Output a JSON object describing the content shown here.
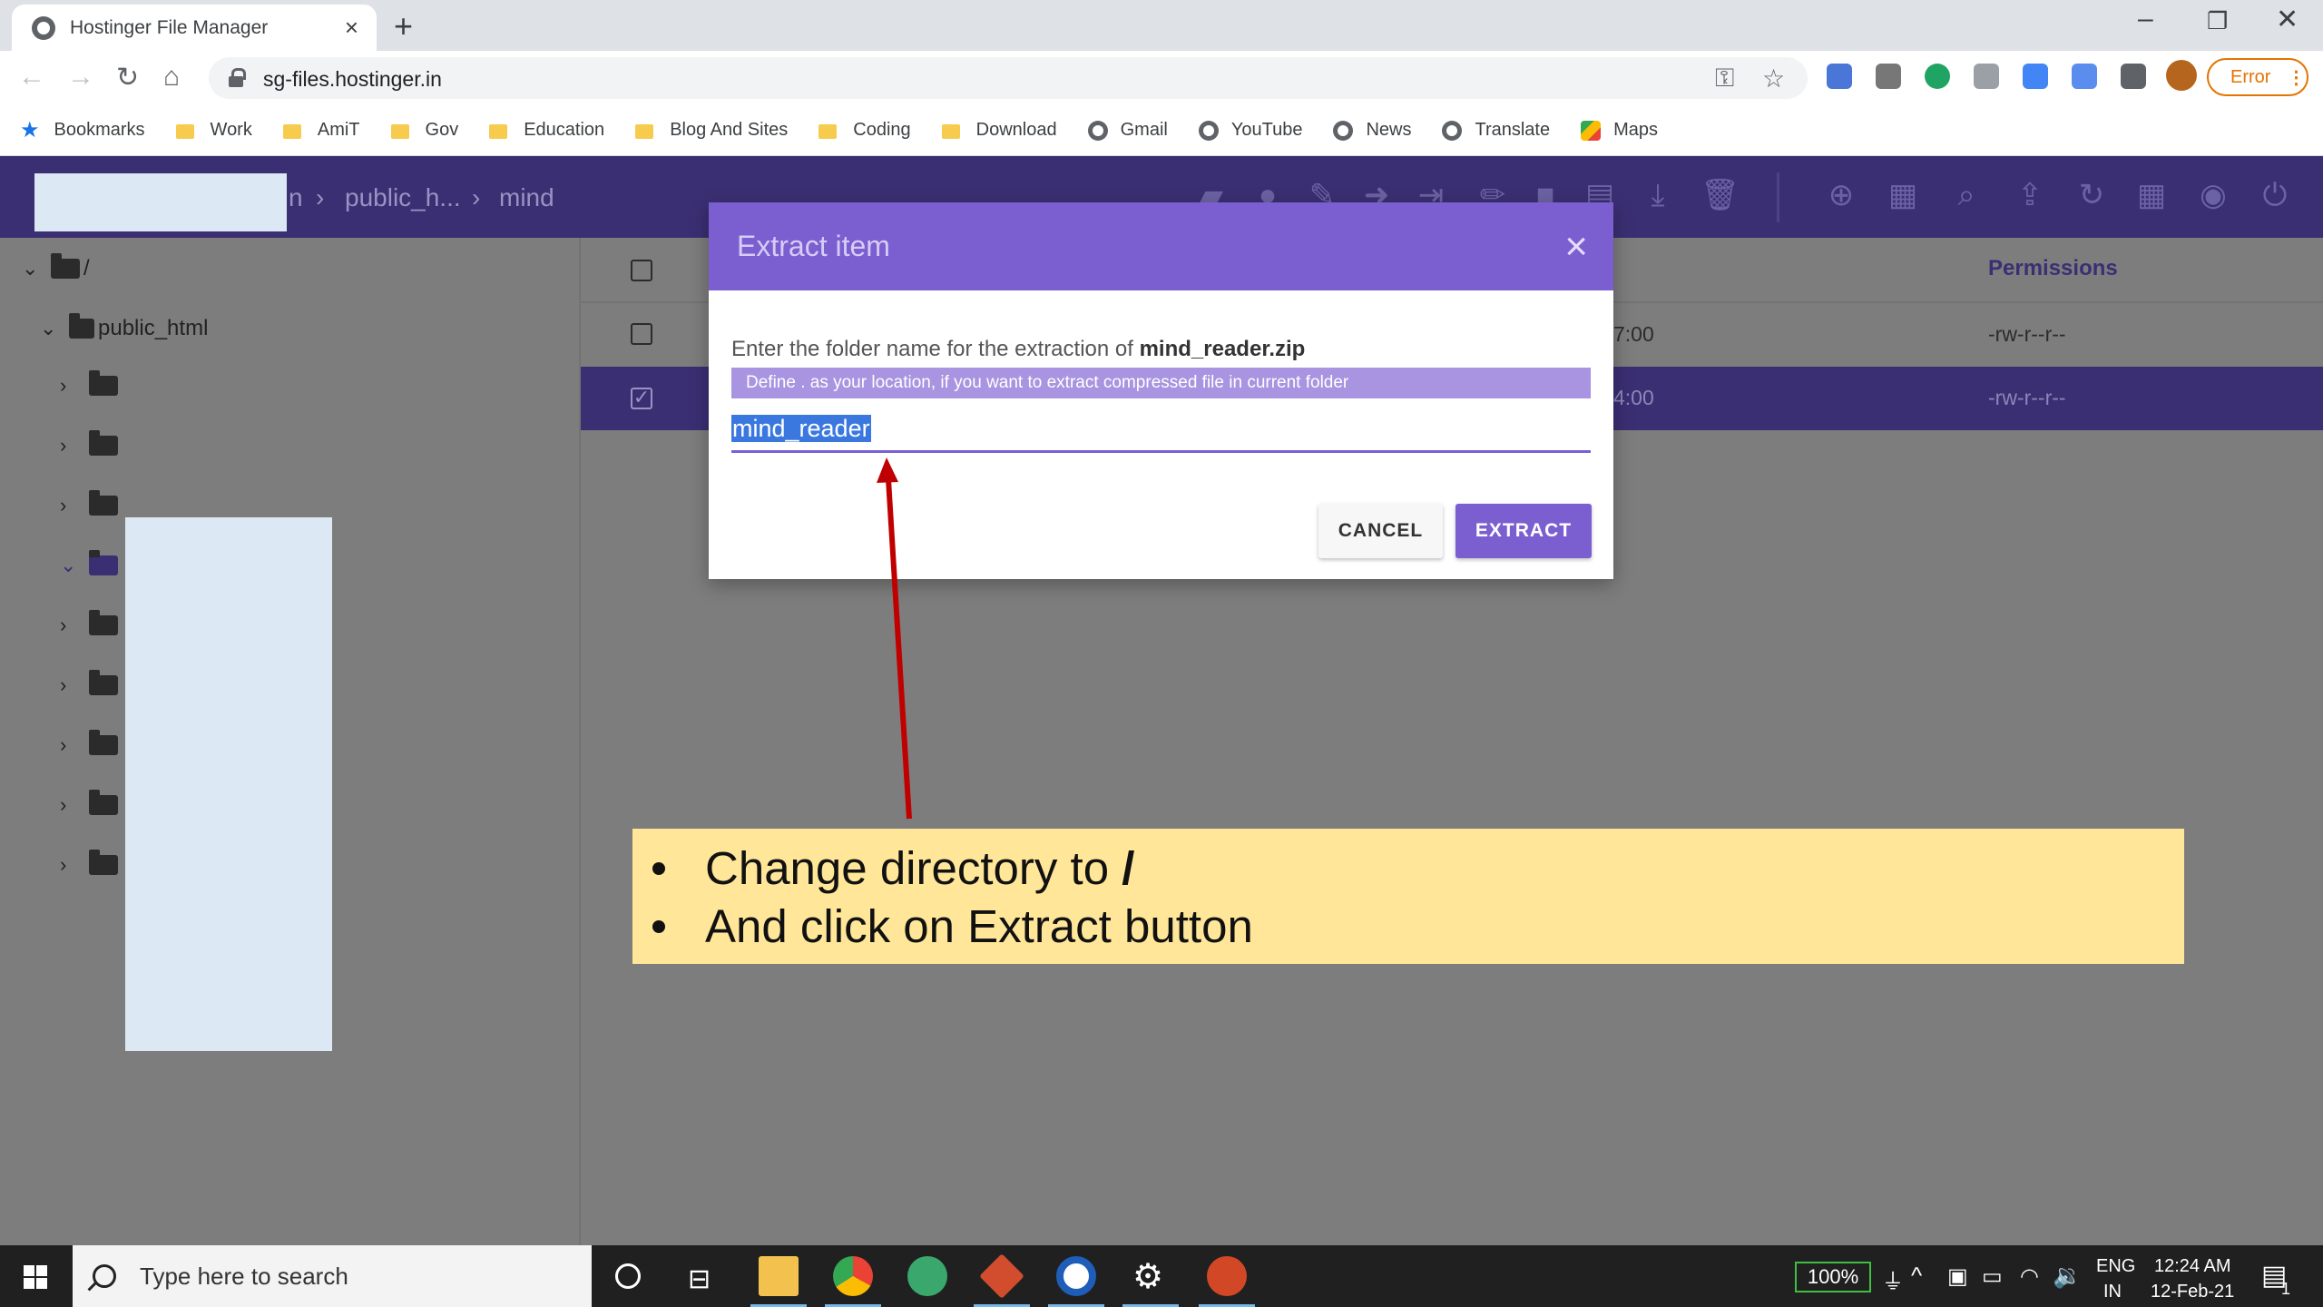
{
  "browser": {
    "tab_title": "Hostinger File Manager",
    "tab_close": "×",
    "new_tab": "+",
    "url": "sg-files.hostinger.in",
    "error_label": "Error",
    "error_menu": "⋮",
    "bookmarks": [
      {
        "label": "Bookmarks",
        "icon": "star-icon"
      },
      {
        "label": "Work",
        "icon": "folder-icon"
      },
      {
        "label": "AmiT",
        "icon": "folder-icon"
      },
      {
        "label": "Gov",
        "icon": "folder-icon"
      },
      {
        "label": "Education",
        "icon": "folder-icon"
      },
      {
        "label": "Blog And Sites",
        "icon": "folder-icon"
      },
      {
        "label": "Coding",
        "icon": "folder-icon"
      },
      {
        "label": "Download",
        "icon": "folder-icon"
      },
      {
        "label": "Gmail",
        "icon": "globe-icon"
      },
      {
        "label": "YouTube",
        "icon": "globe-icon"
      },
      {
        "label": "News",
        "icon": "globe-icon"
      },
      {
        "label": "Translate",
        "icon": "globe-icon"
      },
      {
        "label": "Maps",
        "icon": "maps-icon"
      }
    ]
  },
  "filemanager": {
    "breadcrumb_partial": "n",
    "breadcrumb_public": "public_h...",
    "breadcrumb_mind": "mind",
    "tree_root": "/",
    "tree_public": "public_html",
    "permissions_header": "Permissions",
    "rows": [
      {
        "time": "7:00",
        "perm": "-rw-r--r--"
      },
      {
        "time": "4:00",
        "perm": "-rw-r--r--"
      }
    ],
    "colors": {
      "header": "#3b2f73",
      "accent": "#7b5fd1"
    }
  },
  "dialog": {
    "title": "Extract item",
    "close": "×",
    "prompt_prefix": "Enter the folder name for the extraction of",
    "file_name": "mind_reader.zip",
    "hint": "Define . as your location, if you want to extract compressed file in current folder",
    "input_value": "mind_reader",
    "cancel_label": "CANCEL",
    "extract_label": "EXTRACT"
  },
  "annotation": {
    "line1_prefix": "Change directory to ",
    "line1_bold": "/",
    "line2": "And click on Extract button"
  },
  "taskbar": {
    "search_placeholder": "Type here to search",
    "battery": "100%",
    "lang_top": "ENG",
    "lang_bottom": "IN",
    "time": "12:24 AM",
    "date": "12-Feb-21",
    "notif_count": "1"
  }
}
